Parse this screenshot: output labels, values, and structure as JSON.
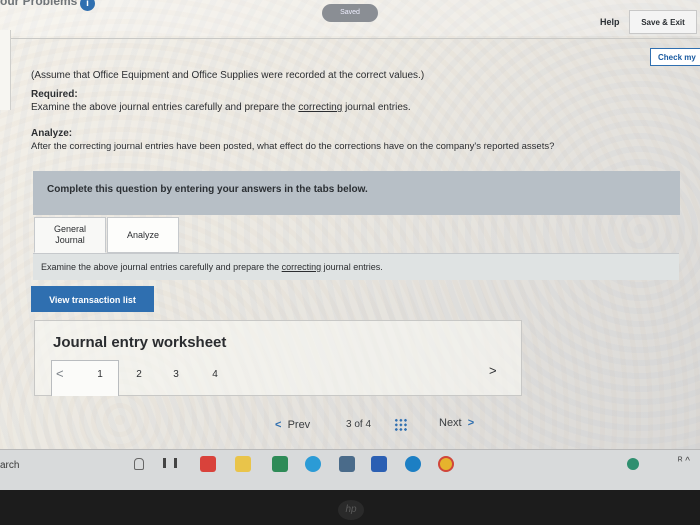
{
  "header": {
    "brand": "our Problems",
    "info_badge": "i",
    "saved_label": "Saved",
    "help_label": "Help",
    "save_exit_label": "Save & Exit",
    "check_my_label": "Check my"
  },
  "instructions": {
    "assume": "(Assume that Office Equipment and Office Supplies were recorded at the correct values.)",
    "required_heading": "Required:",
    "required_pre": "Examine the above journal entries carefully and prepare the ",
    "required_link": "correcting",
    "required_post": " journal entries.",
    "analyze_heading": "Analyze:",
    "analyze_text": "After the correcting journal entries have been posted, what effect do the corrections have on the company's reported assets?"
  },
  "question": {
    "complete_text": "Complete this question by entering your answers in the tabs below."
  },
  "tabs": [
    {
      "line1": "General",
      "line2": "Journal",
      "active": true
    },
    {
      "label": "Analyze",
      "active": false
    }
  ],
  "tab_panel": {
    "pre": "Examine the above journal entries carefully and prepare the ",
    "link": "correcting",
    "post": " journal entries."
  },
  "view_button": "View transaction list",
  "worksheet": {
    "title": "Journal entry worksheet",
    "prev_arrow": "<",
    "next_arrow": ">",
    "pages": [
      "1",
      "2",
      "3",
      "4"
    ],
    "active_page": "1"
  },
  "navigation": {
    "prev_chev": "<",
    "prev_label": "Prev",
    "page_current": "3",
    "page_of": "of",
    "page_total": "4",
    "next_label": "Next",
    "next_chev": ">"
  },
  "taskbar": {
    "search_label": "arch",
    "tray_text": "ᴿ ^"
  },
  "colors": {
    "accent": "#2f6fb0",
    "complete_bar": "#b7bfc6",
    "tab_panel": "#dfe3e3"
  }
}
